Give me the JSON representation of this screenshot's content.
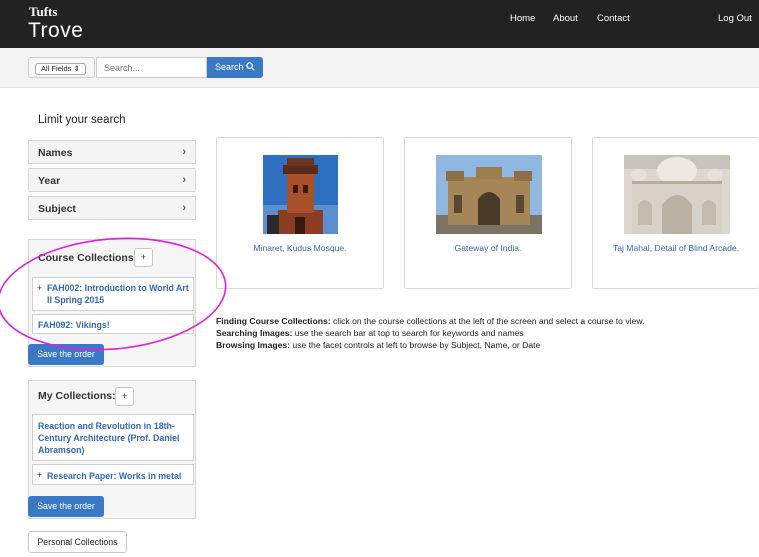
{
  "navbar": {
    "brand_small": "Tufts",
    "brand_large": "Trove",
    "links": [
      "Home",
      "About",
      "Contact"
    ],
    "logout": "Log Out"
  },
  "search": {
    "field_select": "All Fields",
    "placeholder": "Search...",
    "button": "Search"
  },
  "sidebar": {
    "title": "Limit your search",
    "facets": [
      "Names",
      "Year",
      "Subject"
    ],
    "course_collections": {
      "title": "Course Collections:",
      "add": "+",
      "items": [
        "FAH002: Introduction to World Art II Spring 2015",
        "FAH092: Vikings!"
      ],
      "save": "Save the order"
    },
    "my_collections": {
      "title": "My Collections:",
      "add": "+",
      "items": [
        "Reaction and Revolution in 18th-Century Architecture (Prof. Daniel Abramson)",
        "Research Paper: Works in metal"
      ],
      "save": "Save the order"
    },
    "personal": "Personal Collections"
  },
  "cards": [
    {
      "caption": "Minaret, Kudus Mosque."
    },
    {
      "caption": "Gateway of India."
    },
    {
      "caption": "Taj Mahal, Detail of Blind Arcade."
    }
  ],
  "help": [
    {
      "label": "Finding Course Collections:",
      "text": " click on the course collections at the left of the screen and select a course to view."
    },
    {
      "label": "Searching Images:",
      "text": " use the search bar at top to search for keywords and names"
    },
    {
      "label": "Browsing Images:",
      "text": " use the facet controls at left to browse by Subject, Name, or Date"
    }
  ],
  "colors": {
    "navbar": "#222222",
    "accent": "#3a79c5",
    "link": "#3369b3",
    "annotation": "#e020d8"
  }
}
